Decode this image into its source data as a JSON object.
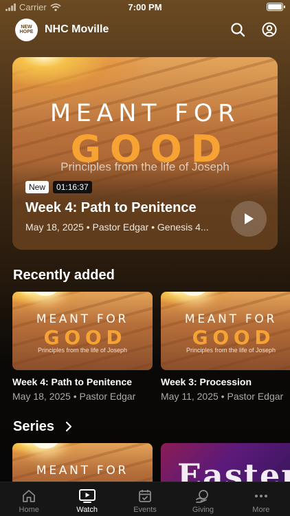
{
  "status_bar": {
    "carrier": "Carrier",
    "time": "7:00 PM"
  },
  "header": {
    "logo_text": "NEW HOPE",
    "title": "NHC Moville",
    "search_icon": "search-icon",
    "profile_icon": "user-circle-icon"
  },
  "sermon_art": {
    "line1": "MEANT FOR",
    "line2": "GOOD",
    "line3": "Principles from the life of Joseph"
  },
  "hero": {
    "badge": "New",
    "duration": "01:16:37",
    "title": "Week 4: Path to Penitence",
    "meta": "May 18, 2025 • Pastor Edgar • Genesis 4...",
    "play_icon": "play-icon"
  },
  "recently_added": {
    "title": "Recently added",
    "items": [
      {
        "title": "Week 4: Path to Penitence",
        "meta": "May 18, 2025 • Pastor Edgar"
      },
      {
        "title": "Week 3: Procession",
        "meta": "May 11, 2025 • Pastor Edgar"
      }
    ]
  },
  "series": {
    "title": "Series",
    "chevron_icon": "chevron-right-icon",
    "items": [
      {
        "art": "meant-for-good"
      },
      {
        "art_text": "Easter"
      }
    ]
  },
  "tab_bar": {
    "active": "Watch",
    "tabs": [
      {
        "label": "Home",
        "icon": "home-icon"
      },
      {
        "label": "Watch",
        "icon": "tv-play-icon"
      },
      {
        "label": "Events",
        "icon": "calendar-icon"
      },
      {
        "label": "Giving",
        "icon": "giving-icon"
      },
      {
        "label": "More",
        "icon": "more-icon"
      }
    ]
  },
  "colors": {
    "accent_orange": "#f6a333",
    "tab_active": "#ffffff",
    "tab_inactive": "#8a8a8a"
  }
}
